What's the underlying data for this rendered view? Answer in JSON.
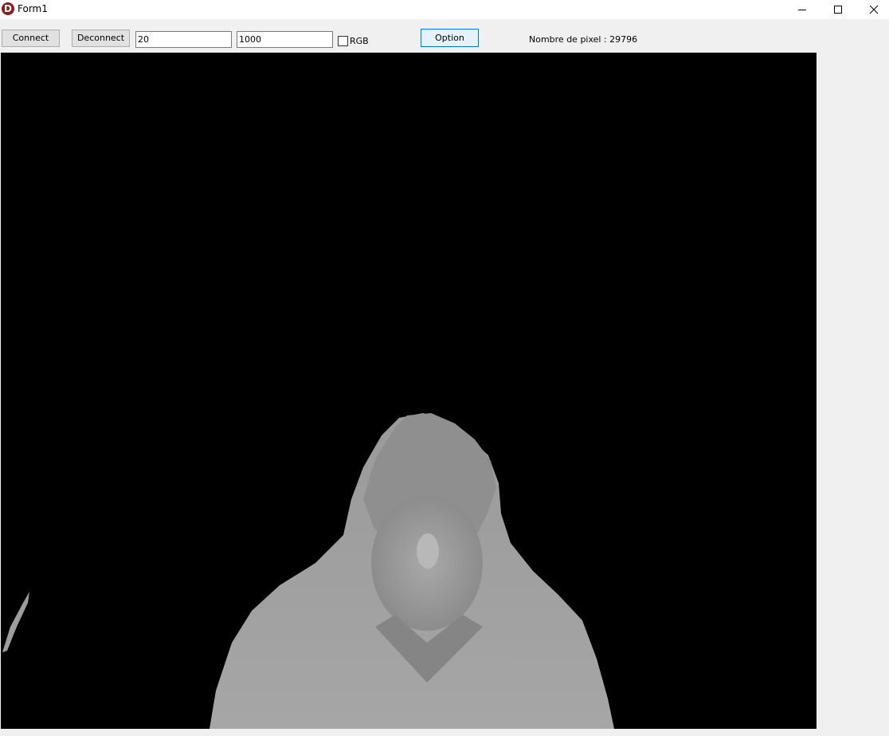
{
  "window": {
    "title": "Form1",
    "icon_letter": "D"
  },
  "toolbar": {
    "connect_label": "Connect",
    "deconnect_label": "Deconnect",
    "min_value": "20",
    "max_value": "1000",
    "rgb_label": "RGB",
    "rgb_checked": false,
    "option_label": "Option",
    "pixel_count_text": "Nombre de pixel : 29796"
  },
  "depth_view": {
    "background_color": "#000000",
    "subject_color": "#9a9a9a"
  }
}
